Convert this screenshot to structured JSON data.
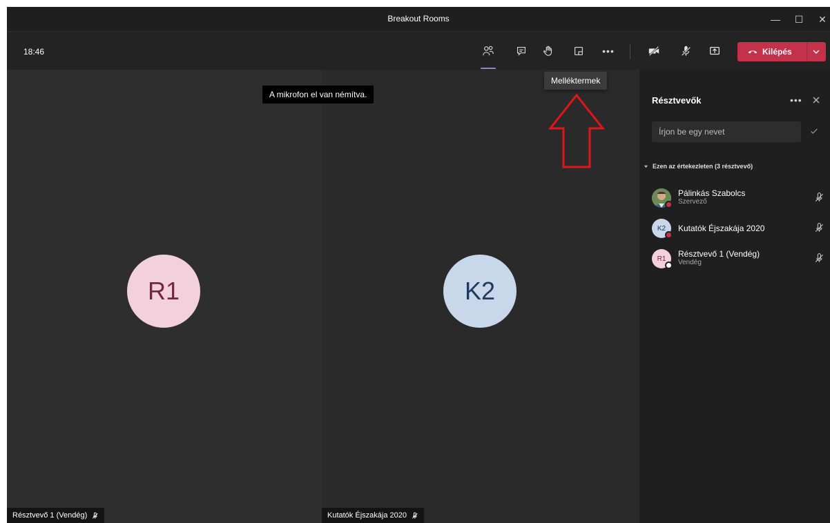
{
  "window": {
    "title": "Breakout Rooms",
    "controls": {
      "minimize": "—",
      "maximize": "☐",
      "close": "✕"
    }
  },
  "toolbar": {
    "time": "18:46",
    "leave_label": "Kilépés"
  },
  "tooltip": "Melléktermek",
  "toast": "A mikrofon el van némítva.",
  "stage": {
    "tiles": [
      {
        "initials": "R1",
        "name": "Résztvevő 1 (Vendég)",
        "avatar_bg": "#f2d0dc",
        "avatar_fg": "#7a2341"
      },
      {
        "initials": "K2",
        "name": "Kutatók Éjszakája 2020",
        "avatar_bg": "#c8d7ea",
        "avatar_fg": "#1f3a60"
      }
    ]
  },
  "panel": {
    "title": "Résztvevők",
    "more": "•••",
    "search_placeholder": "Írjon be egy nevet",
    "section_label": "Ezen az értekezleten (3 résztvevő)",
    "people": [
      {
        "initials": "",
        "name": "Pálinkás Szabolcs",
        "role": "Szervező",
        "status_color": "#c4314b"
      },
      {
        "initials": "K2",
        "name": "Kutatók Éjszakája 2020",
        "role": "",
        "status_color": "#c4314b"
      },
      {
        "initials": "R1",
        "name": "Résztvevő 1 (Vendég)",
        "role": "Vendég",
        "status_color": "#ffffff"
      }
    ]
  },
  "colors": {
    "accent": "#8b8cc7",
    "leave": "#c4314b",
    "arrow": "#e0161b"
  }
}
